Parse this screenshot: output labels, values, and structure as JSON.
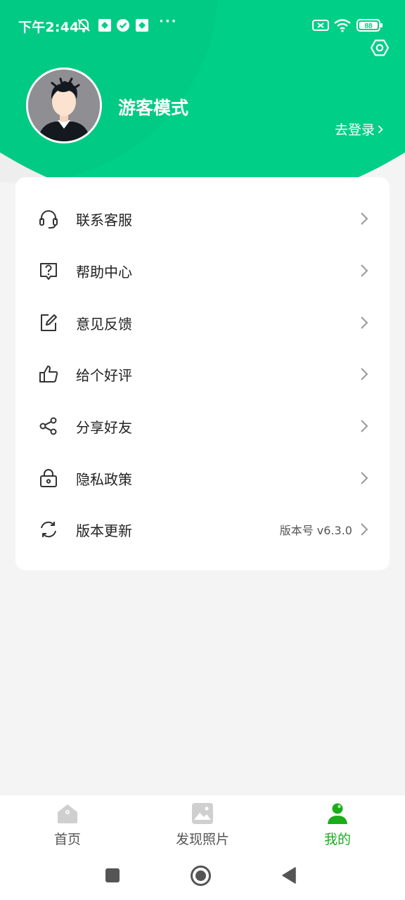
{
  "status_bar": {
    "time": "下午2:44",
    "icons": [
      "mute-icon",
      "app-icon",
      "check-icon",
      "app-icon",
      "more-dots-icon",
      "no-sim-icon",
      "wifi-icon",
      "battery-icon"
    ],
    "more": "···",
    "battery": "88"
  },
  "header": {
    "username": "游客模式",
    "login_label": "去登录",
    "accent_color": "#00cf87"
  },
  "menu": {
    "items": [
      {
        "label": "联系客服",
        "icon": "headset-icon"
      },
      {
        "label": "帮助中心",
        "icon": "help-icon"
      },
      {
        "label": "意见反馈",
        "icon": "edit-icon"
      },
      {
        "label": "给个好评",
        "icon": "thumbs-up-icon"
      },
      {
        "label": "分享好友",
        "icon": "share-icon"
      },
      {
        "label": "隐私政策",
        "icon": "lock-icon"
      },
      {
        "label": "版本更新",
        "icon": "refresh-icon",
        "extra": "版本号 v6.3.0"
      }
    ]
  },
  "tabbar": {
    "tabs": [
      {
        "label": "首页",
        "icon": "home-icon",
        "active": false
      },
      {
        "label": "发现照片",
        "icon": "photo-icon",
        "active": false
      },
      {
        "label": "我的",
        "icon": "user-icon",
        "active": true
      }
    ],
    "active_color": "#1aad19"
  }
}
